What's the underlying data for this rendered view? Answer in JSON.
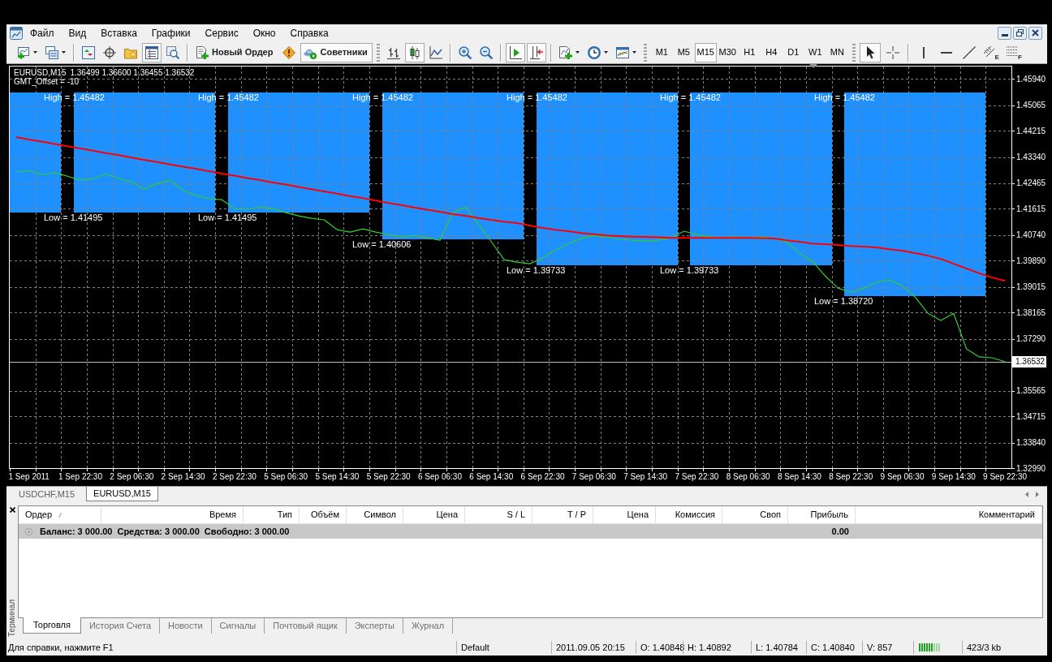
{
  "window": {
    "menu": [
      "Файл",
      "Вид",
      "Вставка",
      "Графики",
      "Сервис",
      "Окно",
      "Справка"
    ]
  },
  "toolbar": {
    "buttons": [
      {
        "kind": "dropdown",
        "pressed": false
      },
      {
        "kind": "dropdown",
        "pressed": false
      },
      {
        "kind": "icon",
        "pressed": false
      },
      {
        "kind": "icon",
        "pressed": false
      },
      {
        "kind": "icon",
        "pressed": false
      },
      {
        "kind": "icon",
        "pressed": true
      },
      {
        "kind": "icon",
        "pressed": false
      },
      {
        "kind": "text",
        "label": "Новый Ордер",
        "pressed": false
      },
      {
        "kind": "icon",
        "pressed": false
      },
      {
        "kind": "text",
        "label": "Советники",
        "pressed": true
      },
      {
        "kind": "icon",
        "pressed": false
      },
      {
        "kind": "icon",
        "pressed": true
      },
      {
        "kind": "icon",
        "pressed": false
      },
      {
        "kind": "icon",
        "pressed": false
      },
      {
        "kind": "icon",
        "pressed": false
      },
      {
        "kind": "icon",
        "pressed": true
      },
      {
        "kind": "icon",
        "pressed": true
      },
      {
        "kind": "dropdown",
        "pressed": false
      },
      {
        "kind": "dropdown",
        "pressed": false
      },
      {
        "kind": "dropdown",
        "pressed": false
      }
    ],
    "periods": [
      {
        "label": "M1",
        "selected": false
      },
      {
        "label": "M5",
        "selected": false
      },
      {
        "label": "M15",
        "selected": true
      },
      {
        "label": "M30",
        "selected": false
      },
      {
        "label": "H1",
        "selected": false
      },
      {
        "label": "H4",
        "selected": false
      },
      {
        "label": "D1",
        "selected": false
      },
      {
        "label": "W1",
        "selected": false
      },
      {
        "label": "MN",
        "selected": false
      }
    ],
    "drawing_tools": [
      {
        "pressed": true
      },
      {
        "pressed": false
      },
      {
        "pressed": false
      },
      {
        "pressed": false
      },
      {
        "pressed": false
      },
      {
        "pressed": false,
        "letter": "E"
      },
      {
        "pressed": false,
        "letter": "F"
      }
    ]
  },
  "chart": {
    "symbol": "EURUSD,M15",
    "quote": "1.36499 1.36600 1.36455 1.36532",
    "indicator_label": "GMT_Offset = -10",
    "chart_data": [
      {
        "type": "line",
        "grid": true,
        "ylim": [
          1.3299,
          1.4635
        ],
        "categories": [
          null,
          "1 Sep 2011",
          null,
          null,
          null,
          "1 Sep 22:30",
          null,
          null,
          null,
          "2 Sep 06:30",
          null,
          null,
          null,
          "2 Sep 14:30",
          null,
          null,
          null,
          "2 Sep 22:30",
          null,
          null,
          null,
          "5 Sep 06:30",
          null,
          null,
          null,
          "5 Sep 14:30",
          null,
          null,
          null,
          "5 Sep 22:30",
          null,
          null,
          null,
          "6 Sep 06:30",
          null,
          null,
          null,
          "6 Sep 14:30",
          null,
          null,
          null,
          "6 Sep 22:30",
          null,
          null,
          null,
          "7 Sep 06:30",
          null,
          null,
          null,
          "7 Sep 14:30",
          null,
          null,
          null,
          "7 Sep 22:30",
          null,
          null,
          null,
          "8 Sep 06:30",
          null,
          null,
          null,
          "8 Sep 14:30",
          null,
          null,
          null,
          "8 Sep 22:30",
          null,
          null,
          null,
          "9 Sep 06:30",
          null,
          null,
          null,
          "9 Sep 14:30",
          null,
          null,
          null,
          "9 Sep 22:30"
        ],
        "yticks": [
          {
            "value": 1.4594,
            "label": "1.45940"
          },
          1.45065,
          1.44215,
          {
            "value": 1.4334,
            "label": "1.43340"
          },
          1.42465,
          1.41615,
          {
            "value": 1.4074,
            "label": "1.40740"
          },
          {
            "value": 1.3989,
            "label": "1.39890"
          },
          1.39015,
          1.38165,
          {
            "value": 1.3729,
            "label": "1.37290"
          },
          1.35565,
          1.34715,
          {
            "value": 1.3384,
            "label": "1.33840"
          },
          {
            "value": 1.3299,
            "label": "1.32990"
          }
        ],
        "series": [
          {
            "type": "bar",
            "color": "#1e90ff",
            "values": [
              0.0399,
              0.0399,
              0.0399,
              0.0399,
              null,
              0.0399,
              0.0399,
              0.0399,
              0.0399,
              0.0399,
              0.0399,
              0.0399,
              0.0399,
              0.0399,
              0.0399,
              0.0399,
              null,
              0.0399,
              0.0399,
              0.0399,
              0.0399,
              0.0399,
              0.0399,
              0.0399,
              0.0399,
              0.0399,
              0.0399,
              0.0399,
              null,
              0.0488,
              0.0488,
              0.0488,
              0.0488,
              0.0488,
              0.0488,
              0.0488,
              0.0488,
              0.0488,
              0.0488,
              0.0488,
              null,
              0.0575,
              0.0575,
              0.0575,
              0.0575,
              0.0575,
              0.0575,
              0.0575,
              0.0575,
              0.0575,
              0.0575,
              0.0575,
              null,
              0.0575,
              0.0575,
              0.0575,
              0.0575,
              0.0575,
              0.0575,
              0.0575,
              0.0575,
              0.0575,
              0.0575,
              0.0575,
              null,
              0.0676,
              0.0676,
              0.0676,
              0.0676,
              0.0676,
              0.0676,
              0.0676,
              0.0676,
              0.0676,
              0.0676,
              0.0676,
              null,
              null
            ],
            "base": [
              1.415,
              1.415,
              1.415,
              1.415,
              null,
              1.415,
              1.415,
              1.415,
              1.415,
              1.415,
              1.415,
              1.415,
              1.415,
              1.415,
              1.415,
              1.415,
              null,
              1.415,
              1.415,
              1.415,
              1.415,
              1.415,
              1.415,
              1.415,
              1.415,
              1.415,
              1.415,
              1.415,
              null,
              1.4061,
              1.4061,
              1.4061,
              1.4061,
              1.4061,
              1.4061,
              1.4061,
              1.4061,
              1.4061,
              1.4061,
              1.4061,
              null,
              1.3973,
              1.3973,
              1.3973,
              1.3973,
              1.3973,
              1.3973,
              1.3973,
              1.3973,
              1.3973,
              1.3973,
              1.3973,
              null,
              1.3973,
              1.3973,
              1.3973,
              1.3973,
              1.3973,
              1.3973,
              1.3973,
              1.3973,
              1.3973,
              1.3973,
              1.3973,
              null,
              1.3872,
              1.3872,
              1.3872,
              1.3872,
              1.3872,
              1.3872,
              1.3872,
              1.3872,
              1.3872,
              1.3872,
              1.3872,
              null,
              null
            ]
          },
          {
            "color": "#32cd32",
            "values": [
              1.4284,
              1.4289,
              1.4276,
              1.4281,
              1.427,
              1.4257,
              1.4262,
              1.4278,
              1.4262,
              1.4251,
              1.4227,
              1.4246,
              1.4257,
              1.4222,
              1.4206,
              1.4195,
              1.4192,
              1.4162,
              1.416,
              1.4168,
              1.4162,
              1.4149,
              1.4138,
              1.413,
              1.4125,
              1.4092,
              1.4084,
              1.4095,
              1.4084,
              1.4076,
              1.4068,
              1.4073,
              1.4065,
              1.4057,
              1.4149,
              1.4168,
              1.4111,
              1.4052,
              1.3992,
              1.3984,
              1.3979,
              1.3998,
              1.4025,
              1.4046,
              1.4063,
              1.4073,
              1.4068,
              1.406,
              1.4057,
              1.4054,
              1.4057,
              1.4065,
              1.4087,
              1.4076,
              1.4068,
              1.4065,
              1.4068,
              1.4065,
              1.4068,
              1.4063,
              1.4052,
              1.4014,
              1.3987,
              1.3938,
              1.3898,
              1.3884,
              1.3898,
              1.3917,
              1.3925,
              1.3906,
              1.3868,
              1.3814,
              1.379,
              1.3814,
              1.3696,
              1.3669,
              1.3666,
              1.3653
            ]
          },
          {
            "color": "#ff0000",
            "values": [
              1.44,
              1.4392,
              1.4385,
              1.4377,
              1.437,
              1.4362,
              1.4355,
              1.4347,
              1.434,
              1.4332,
              1.4324,
              1.4317,
              1.4309,
              1.4302,
              1.4295,
              1.4287,
              1.4279,
              1.4272,
              1.4264,
              1.4257,
              1.4249,
              1.4242,
              1.4234,
              1.4227,
              1.4219,
              1.4212,
              1.4204,
              1.4197,
              1.4189,
              1.4181,
              1.4174,
              1.4166,
              1.4159,
              1.4152,
              1.4144,
              1.4138,
              1.4131,
              1.4125,
              1.4119,
              1.4114,
              1.4106,
              1.4098,
              1.4092,
              1.4087,
              1.4081,
              1.4077,
              1.4073,
              1.4071,
              1.4069,
              1.4068,
              1.4067,
              1.4065,
              1.4065,
              1.4065,
              1.4065,
              1.4065,
              1.4065,
              1.4065,
              1.4064,
              1.4063,
              1.4057,
              1.4052,
              1.4046,
              1.4044,
              1.4041,
              1.4038,
              1.4036,
              1.4033,
              1.4027,
              1.4022,
              1.4014,
              1.4006,
              1.3995,
              1.3979,
              1.3963,
              1.3947,
              1.3933,
              1.3922
            ]
          }
        ],
        "ref_lines": [
          {
            "axis": "y",
            "value": 1.36532,
            "label": "1.36532",
            "color": "#c0c0c0"
          }
        ],
        "annotations": [
          "High = 1.45482",
          "Low = 1.41495",
          "High = 1.45482",
          "Low = 1.41495",
          "High = 1.45482",
          "Low = 1.40606",
          "High = 1.45482",
          "Low = 1.39733",
          "High = 1.45482",
          "Low = 1.39733",
          "High = 1.45482",
          "Low = 1.38720"
        ]
      }
    ]
  },
  "chart_tabs": [
    {
      "label": "USDCHF,M15",
      "selected": false
    },
    {
      "label": "EURUSD,M15",
      "selected": true
    }
  ],
  "terminal": {
    "side_label": "Терминал",
    "columns": [
      {
        "label": "Ордер",
        "sorted": true
      },
      {
        "label": "Время",
        "sorted": false
      },
      {
        "label": "Тип",
        "sorted": false
      },
      {
        "label": "Объём",
        "sorted": false
      },
      {
        "label": "Символ",
        "sorted": false
      },
      {
        "label": "Цена",
        "sorted": false
      },
      {
        "label": "S / L",
        "sorted": false
      },
      {
        "label": "T / P",
        "sorted": false
      },
      {
        "label": "Цена",
        "sorted": false
      },
      {
        "label": "Комиссия",
        "sorted": false
      },
      {
        "label": "Своп",
        "sorted": false
      },
      {
        "label": "Прибыль",
        "sorted": false
      },
      {
        "label": "Комментарий",
        "sorted": false
      }
    ],
    "balance_row": {
      "balance": "Баланс: 3 000.00",
      "equity": "Средства: 3 000.00",
      "free_margin": "Свободно: 3 000.00",
      "profit": "0.00"
    },
    "tabs": [
      {
        "label": "Торговля",
        "selected": true
      },
      {
        "label": "История Счета",
        "selected": false
      },
      {
        "label": "Новости",
        "selected": false
      },
      {
        "label": "Сигналы",
        "selected": false
      },
      {
        "label": "Почтовый ящик",
        "selected": false
      },
      {
        "label": "Эксперты",
        "selected": false
      },
      {
        "label": "Журнал",
        "selected": false
      }
    ]
  },
  "status_bar": {
    "help": "Для справки, нажмите F1",
    "profile": "Default",
    "time": "2011.09.05 20:15",
    "open": "O: 1.40848",
    "high": "H: 1.40892",
    "low": "L: 1.40784",
    "close": "C: 1.40840",
    "volume": "V: 857",
    "traffic": "423/3 kb"
  }
}
